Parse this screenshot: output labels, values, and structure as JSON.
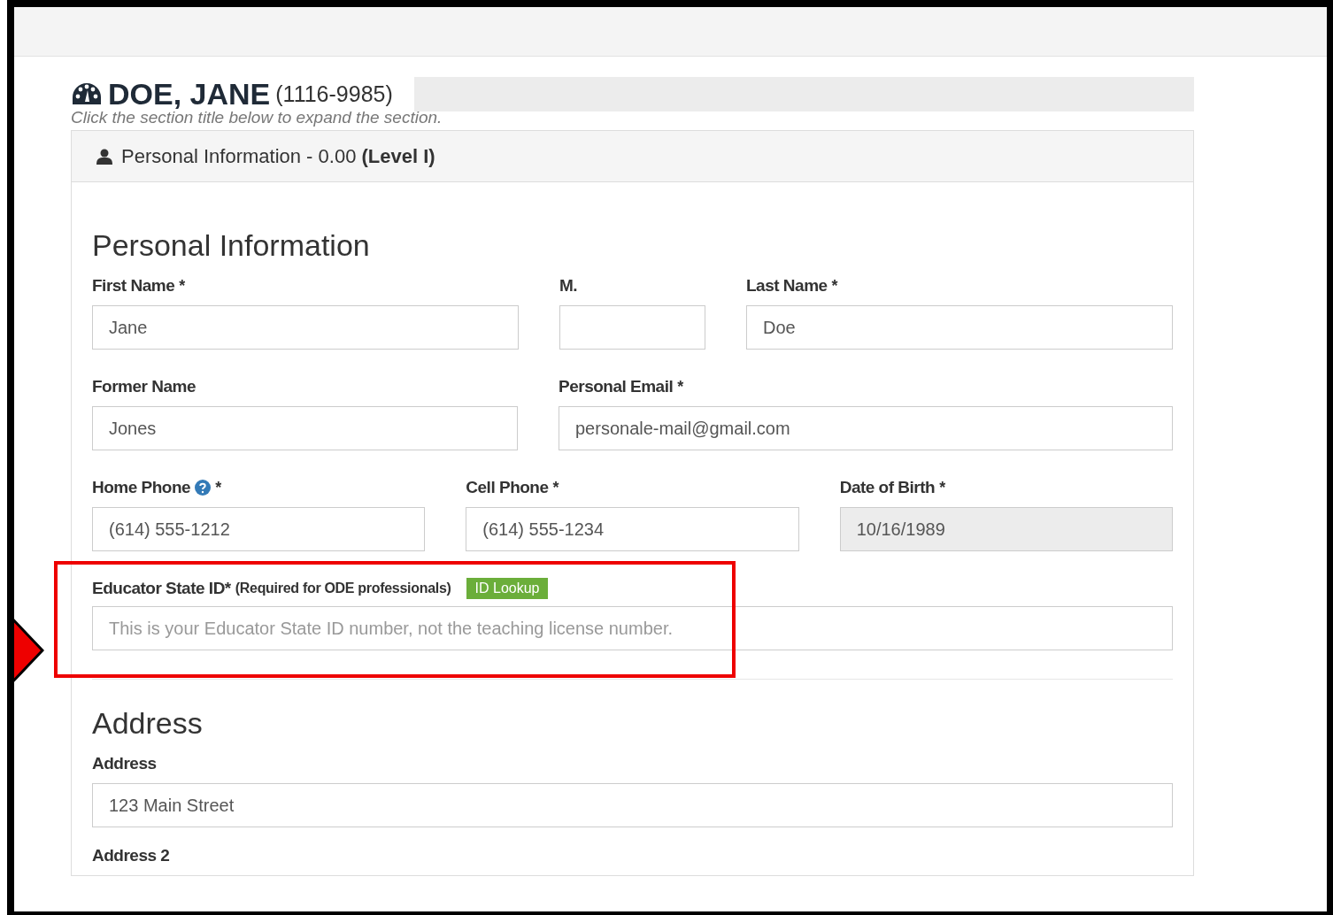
{
  "header": {
    "name": "DOE, JANE",
    "id": "(1116-9985)",
    "hint": "Click the section title below to expand the section."
  },
  "section": {
    "title": "Personal Information - 0.00",
    "level": "(Level I)",
    "expanded": true
  },
  "personal": {
    "heading": "Personal Information",
    "rows": [
      [
        {
          "label": "First Name",
          "required": "*",
          "value": "Jane",
          "disabled": false
        },
        {
          "label": "M.",
          "disabled": false
        },
        {
          "label": "Last Name",
          "required": "*",
          "value": "Doe",
          "disabled": false
        }
      ],
      [
        {
          "label": "Former Name",
          "value": "Jones",
          "disabled": false
        },
        {
          "label": "Personal Email",
          "required": "*",
          "value": "personale-mail@gmail.com",
          "disabled": false
        }
      ],
      [
        {
          "label": "Home Phone",
          "help": true,
          "required": "*",
          "value": "(614) 555-1212",
          "disabled": false
        },
        {
          "label": "Cell Phone",
          "required": "*",
          "value": "(614) 555-1234",
          "disabled": false
        },
        {
          "label": "Date of Birth",
          "required": "*",
          "value": "10/16/1989",
          "disabled": true
        }
      ]
    ],
    "educator": {
      "label": "Educator State ID*",
      "note": "(Required for ODE professionals)",
      "button": "ID Lookup",
      "placeholder": "This is your Educator State ID number, not the teaching license number.",
      "highlighted": true
    }
  },
  "address": {
    "heading": "Address",
    "fields": [
      {
        "label": "Address",
        "value": "123 Main Street"
      },
      {
        "label": "Address 2"
      }
    ]
  }
}
